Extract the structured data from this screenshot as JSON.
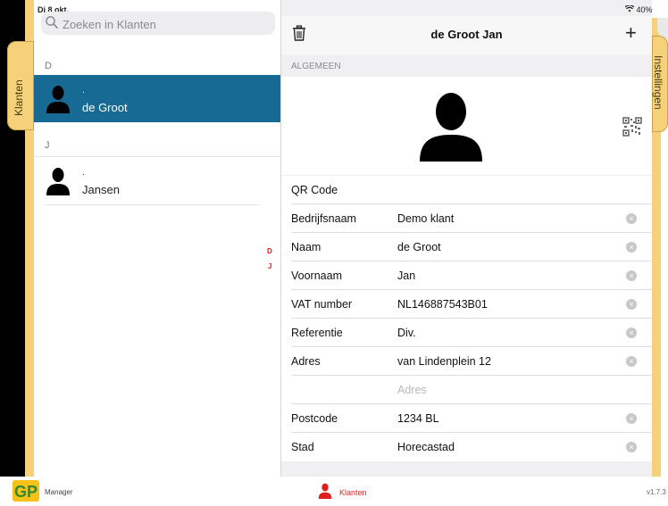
{
  "status": {
    "date": "Di 8 okt.",
    "battery": "40%"
  },
  "tabs": {
    "left": "Klanten",
    "right": "Instellingen"
  },
  "search": {
    "placeholder": "Zoeken in Klanten"
  },
  "list": {
    "sections": [
      {
        "letter": "D",
        "items": [
          {
            "dot": ".",
            "name": "de Groot",
            "selected": true
          }
        ]
      },
      {
        "letter": "J",
        "items": [
          {
            "dot": ".",
            "name": "Jansen",
            "selected": false
          }
        ]
      }
    ],
    "index": [
      "D",
      "J"
    ]
  },
  "detail": {
    "title": "de Groot Jan",
    "section": "ALGEMEEN",
    "qr_label": "QR Code",
    "fields": [
      {
        "label": "Bedrijfsnaam",
        "value": "Demo klant"
      },
      {
        "label": "Naam",
        "value": "de Groot"
      },
      {
        "label": "Voornaam",
        "value": "Jan"
      },
      {
        "label": "VAT number",
        "value": "NL146887543B01"
      },
      {
        "label": "Referentie",
        "value": "Div."
      },
      {
        "label": "Adres",
        "value": "van Lindenplein 12"
      },
      {
        "label": "",
        "placeholder": "Adres"
      },
      {
        "label": "Postcode",
        "value": "1234 BL"
      },
      {
        "label": "Stad",
        "value": "Horecastad"
      }
    ]
  },
  "bottom": {
    "logo": "GP",
    "manager": "Manager",
    "klanten": "Klanten",
    "version": "v1.7.3"
  },
  "colors": {
    "selected_row": "#176a93",
    "tab": "#f5d27a",
    "accent": "#e02020"
  }
}
